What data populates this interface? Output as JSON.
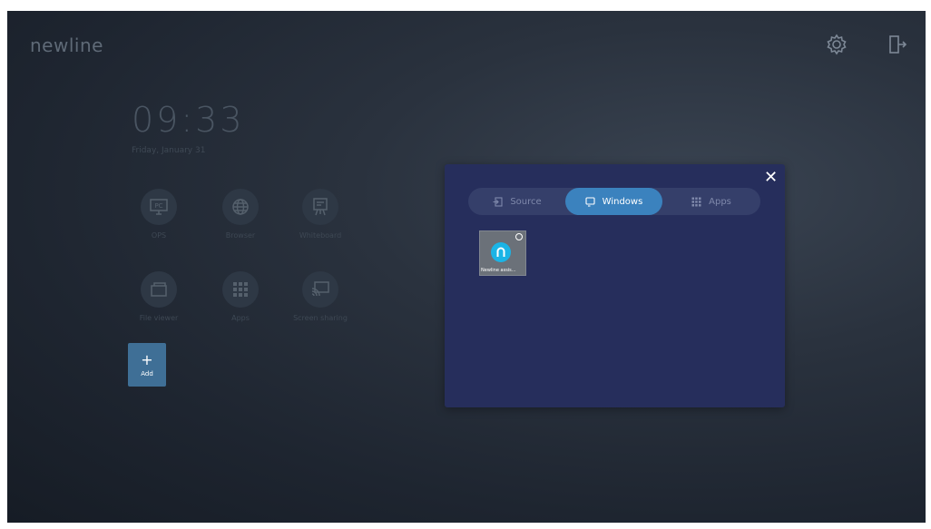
{
  "brand": {
    "logo_text": "newline"
  },
  "topbar": {
    "settings_icon": "gear-icon",
    "exit_icon": "exit-door-icon"
  },
  "clock": {
    "time": "09:33",
    "date": "Friday, January 31"
  },
  "home_apps": [
    {
      "label": "OPS",
      "icon": "pc-monitor-icon"
    },
    {
      "label": "Browser",
      "icon": "globe-icon"
    },
    {
      "label": "Whiteboard",
      "icon": "whiteboard-easel-icon"
    },
    {
      "label": "File viewer",
      "icon": "folder-icon"
    },
    {
      "label": "Apps",
      "icon": "grid-icon"
    },
    {
      "label": "Screen sharing",
      "icon": "cast-screen-icon"
    }
  ],
  "add_tile": {
    "plus": "+",
    "label": "Add"
  },
  "dialog": {
    "close": "✕",
    "tabs": [
      {
        "label": "Source",
        "icon": "source-input-icon",
        "active": false
      },
      {
        "label": "Windows",
        "icon": "window-monitor-icon",
        "active": true
      },
      {
        "label": "Apps",
        "icon": "grid-icon",
        "active": false
      }
    ],
    "windows": [
      {
        "title": "Newline assis...",
        "icon": "newline-n-icon"
      }
    ]
  },
  "colors": {
    "accent": "#3b82be",
    "dialog_bg": "#262e5c",
    "add_tile_bg": "#3f6f96",
    "app_icon_cyan": "#1bb4e6"
  }
}
